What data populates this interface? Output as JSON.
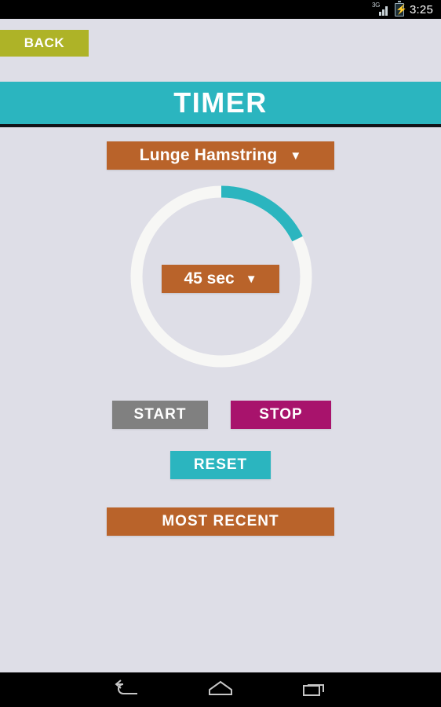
{
  "statusbar": {
    "network_label": "3G",
    "signal_icon": "signal-3g-icon",
    "battery_icon": "battery-charging-icon",
    "time": "3:25"
  },
  "topbar": {
    "back_label": "BACK",
    "back_color": "#aeb327"
  },
  "header": {
    "title": "TIMER",
    "bg_color": "#2bb5bf"
  },
  "exercise": {
    "selected": "Lunge Hamstring",
    "caret": "▼",
    "bg_color": "#b9632a"
  },
  "timer": {
    "duration_label": "45 sec",
    "caret": "▼",
    "progress_percent": 18,
    "progress_degrees": 64,
    "track_color": "#f7f7f5",
    "progress_color": "#2bb5bf",
    "bg_color": "#b9632a"
  },
  "controls": {
    "start_label": "START",
    "start_color": "#808080",
    "stop_label": "STOP",
    "stop_color": "#a8136c",
    "reset_label": "RESET",
    "reset_color": "#2bb5bf",
    "most_recent_label": "MOST RECENT",
    "most_recent_color": "#b9632a"
  },
  "navbar": {
    "back_icon": "android-back-icon",
    "home_icon": "android-home-icon",
    "recents_icon": "android-recents-icon"
  },
  "page": {
    "background_color": "#dedee7"
  }
}
